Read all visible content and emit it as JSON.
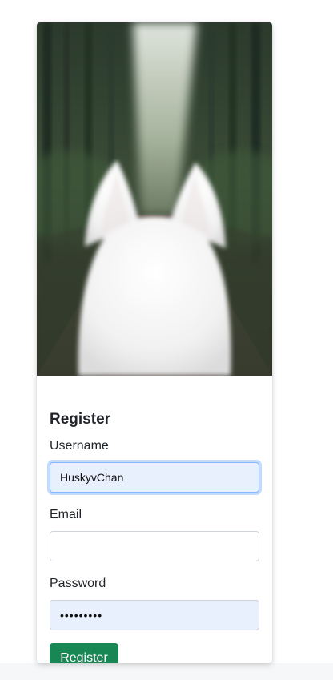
{
  "form": {
    "title": "Register",
    "username_label": "Username",
    "username_value": "HuskyvChan",
    "email_label": "Email",
    "email_value": "",
    "password_label": "Password",
    "password_mask": "•••••••••",
    "submit_label": "Register"
  },
  "colors": {
    "submit_button": "#198754",
    "autofill_background": "#e8f0fe",
    "focus_ring": "#86b7fe"
  },
  "image": {
    "subject": "white-dog-ears-forest-path"
  }
}
